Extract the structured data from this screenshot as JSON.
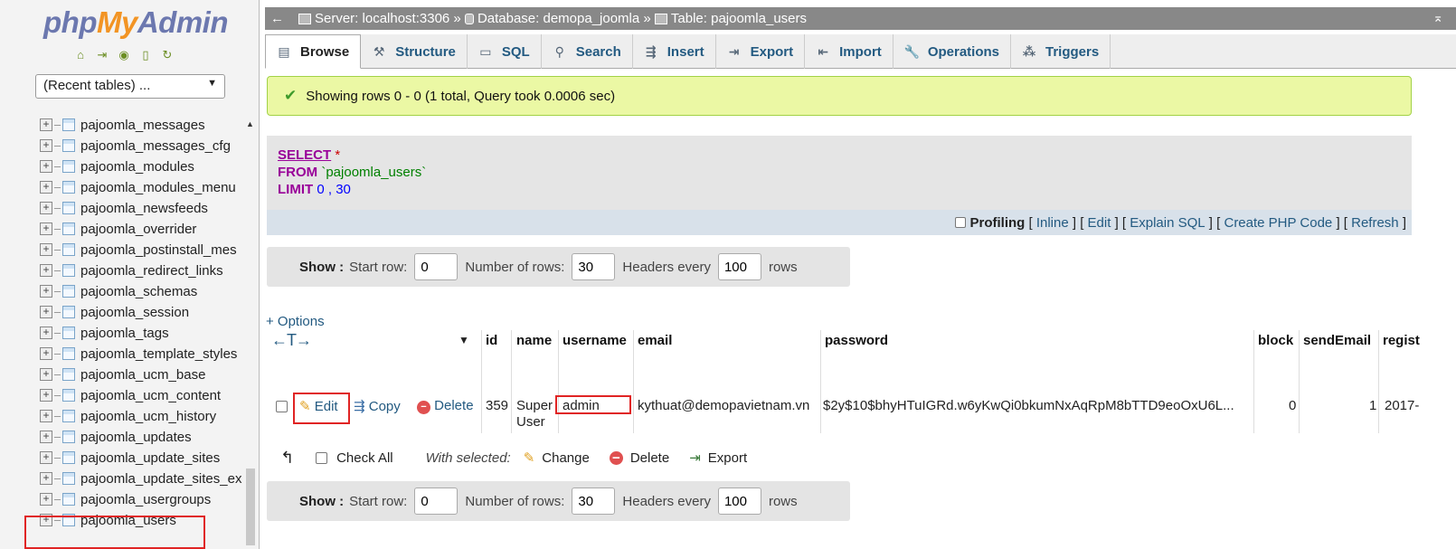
{
  "logo": {
    "part1": "php",
    "part2": "My",
    "part3": "Admin"
  },
  "nav_icons": [
    "home-icon",
    "exit-icon",
    "query-window-icon",
    "docs-icon",
    "reload-icon"
  ],
  "recent_tables": {
    "label": "(Recent tables) ..."
  },
  "tree": {
    "items": [
      "pajoomla_messages",
      "pajoomla_messages_cfg",
      "pajoomla_modules",
      "pajoomla_modules_menu",
      "pajoomla_newsfeeds",
      "pajoomla_overrider",
      "pajoomla_postinstall_mes",
      "pajoomla_redirect_links",
      "pajoomla_schemas",
      "pajoomla_session",
      "pajoomla_tags",
      "pajoomla_template_styles",
      "pajoomla_ucm_base",
      "pajoomla_ucm_content",
      "pajoomla_ucm_history",
      "pajoomla_updates",
      "pajoomla_update_sites",
      "pajoomla_update_sites_ex",
      "pajoomla_usergroups",
      "pajoomla_users"
    ]
  },
  "breadcrumb": {
    "server": "Server: localhost:3306 »",
    "database": "Database: demopa_joomla »",
    "table": "Table: pajoomla_users"
  },
  "tabs": [
    {
      "label": "Browse",
      "icon": "browse-icon"
    },
    {
      "label": "Structure",
      "icon": "structure-icon"
    },
    {
      "label": "SQL",
      "icon": "sql-icon"
    },
    {
      "label": "Search",
      "icon": "search-icon"
    },
    {
      "label": "Insert",
      "icon": "insert-icon"
    },
    {
      "label": "Export",
      "icon": "export-icon"
    },
    {
      "label": "Import",
      "icon": "import-icon"
    },
    {
      "label": "Operations",
      "icon": "operations-icon"
    },
    {
      "label": "Triggers",
      "icon": "triggers-icon"
    }
  ],
  "success_message": "Showing rows 0 - 0 (1 total, Query took 0.0006 sec)",
  "sql": {
    "select": "SELECT",
    "star": "*",
    "from": "FROM",
    "table": "`pajoomla_users`",
    "limit": "LIMIT",
    "limit_start": "0",
    "comma": ",",
    "limit_count": "30"
  },
  "sql_tools": {
    "profiling": "Profiling",
    "inline": "Inline",
    "edit": "Edit",
    "explain": "Explain SQL",
    "create_php": "Create PHP Code",
    "refresh": "Refresh"
  },
  "pager": {
    "show": "Show :",
    "start_row_label": "Start row:",
    "start_row_value": "0",
    "num_rows_label": "Number of rows:",
    "num_rows_value": "30",
    "headers_label": "Headers every",
    "headers_value": "100",
    "rows_label": "rows"
  },
  "options_link": "+ Options",
  "column_arrows": "←T→",
  "columns": [
    "id",
    "name",
    "username",
    "email",
    "password",
    "block",
    "sendEmail",
    "regist"
  ],
  "row": {
    "edit": "Edit",
    "copy": "Copy",
    "delete": "Delete",
    "id": "359",
    "name_line1": "Super",
    "name_line2": "User",
    "username": "admin",
    "email": "kythuat@demopavietnam.vn",
    "password": "$2y$10$bhyHTuIGRd.w6yKwQi0bkumNxAqRpM8bTTD9eoOxU6L...",
    "block": "0",
    "sendEmail": "1",
    "register_date": "2017-"
  },
  "bulk": {
    "check_all": "Check All",
    "with_selected": "With selected:",
    "change": "Change",
    "delete": "Delete",
    "export": "Export"
  }
}
